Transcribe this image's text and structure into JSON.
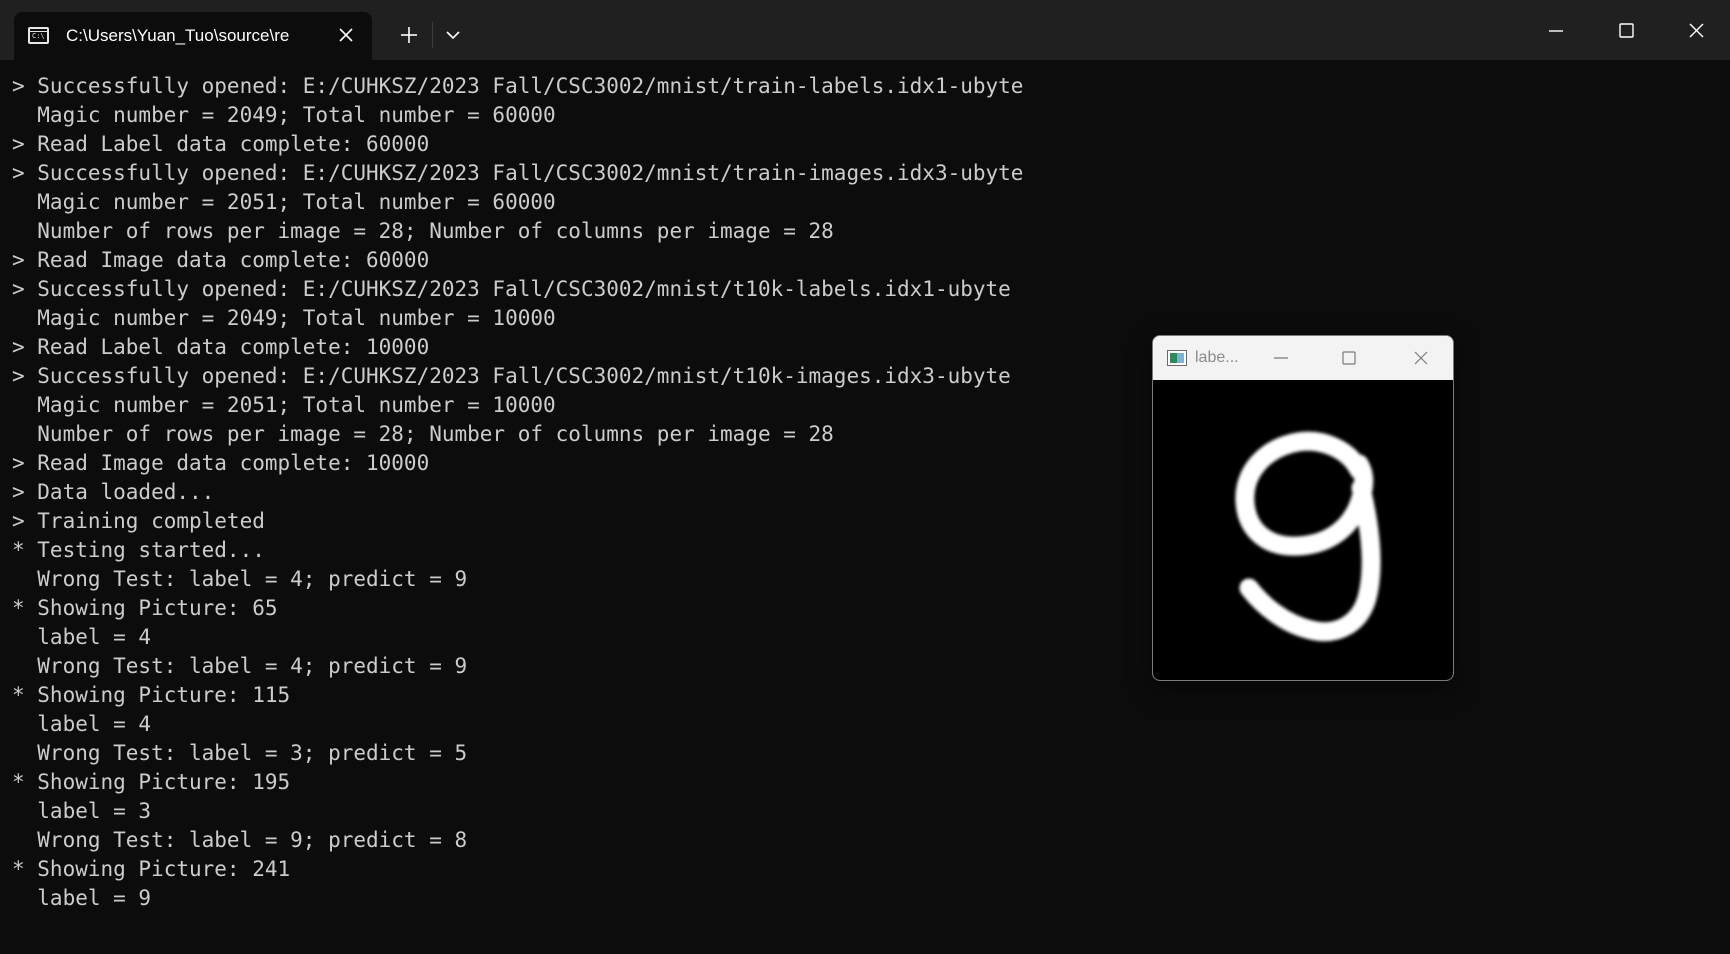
{
  "window": {
    "tab_title": "C:\\Users\\Yuan_Tuo\\source\\re",
    "icons": {
      "tab": "terminal-icon",
      "close": "close-icon",
      "new_tab": "plus-icon",
      "dropdown": "chevron-down-icon",
      "minimize": "minimize-icon",
      "maximize": "maximize-icon"
    },
    "colors": {
      "background": "#0c0c0c",
      "titlebar": "#202020",
      "text": "#cccccc"
    }
  },
  "terminal": {
    "lines": [
      "> Successfully opened: E:/CUHKSZ/2023 Fall/CSC3002/mnist/train-labels.idx1-ubyte",
      "  Magic number = 2049; Total number = 60000",
      "> Read Label data complete: 60000",
      "> Successfully opened: E:/CUHKSZ/2023 Fall/CSC3002/mnist/train-images.idx3-ubyte",
      "  Magic number = 2051; Total number = 60000",
      "  Number of rows per image = 28; Number of columns per image = 28",
      "> Read Image data complete: 60000",
      "> Successfully opened: E:/CUHKSZ/2023 Fall/CSC3002/mnist/t10k-labels.idx1-ubyte",
      "  Magic number = 2049; Total number = 10000",
      "> Read Label data complete: 10000",
      "> Successfully opened: E:/CUHKSZ/2023 Fall/CSC3002/mnist/t10k-images.idx3-ubyte",
      "  Magic number = 2051; Total number = 10000",
      "  Number of rows per image = 28; Number of columns per image = 28",
      "> Read Image data complete: 10000",
      "> Data loaded...",
      "> Training completed",
      "* Testing started...",
      "  Wrong Test: label = 4; predict = 9",
      "* Showing Picture: 65",
      "  label = 4",
      "  Wrong Test: label = 4; predict = 9",
      "* Showing Picture: 115",
      "  label = 4",
      "  Wrong Test: label = 3; predict = 5",
      "* Showing Picture: 195",
      "  label = 3",
      "  Wrong Test: label = 9; predict = 8",
      "* Showing Picture: 241",
      "  label = 9"
    ]
  },
  "image_window": {
    "title": "labe...",
    "image_alt": "handwritten digit 9",
    "icons": {
      "app": "image-icon",
      "minimize": "minimize-icon",
      "maximize": "maximize-icon",
      "close": "close-icon"
    }
  }
}
